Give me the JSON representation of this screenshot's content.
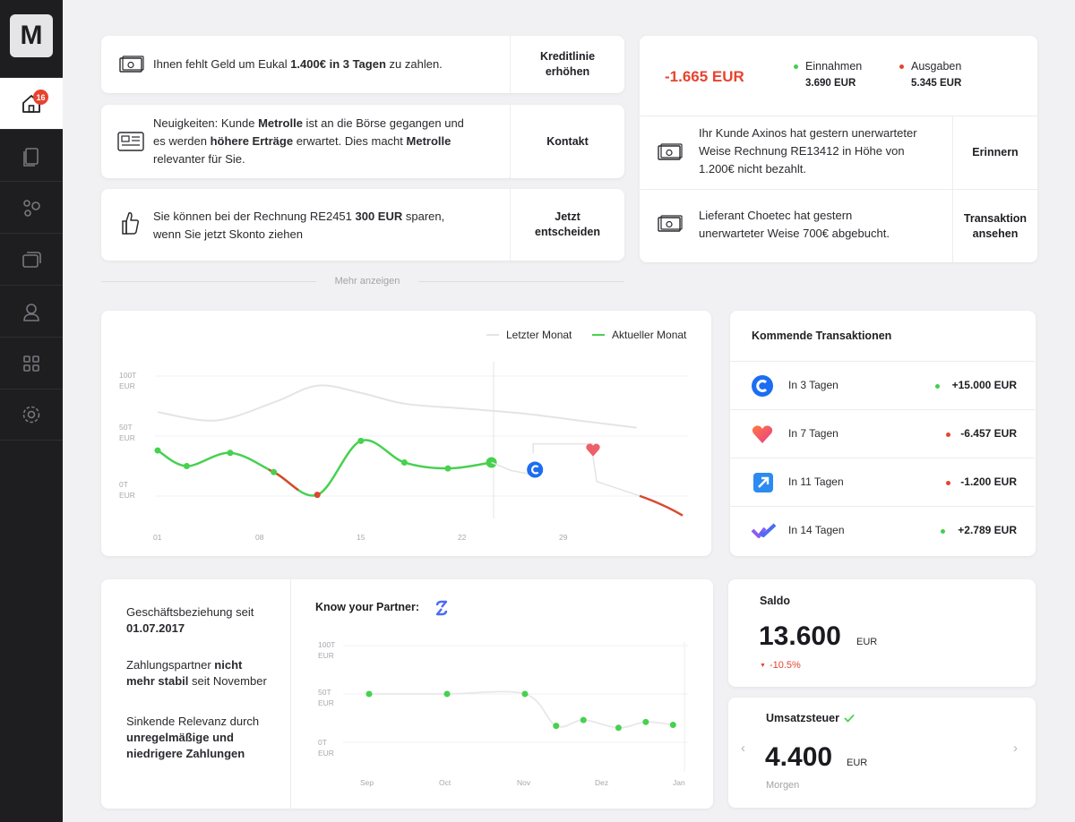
{
  "sidebar": {
    "logo": "M",
    "badge_count": "16",
    "items": [
      {
        "icon": "home-icon"
      },
      {
        "icon": "documents-icon"
      },
      {
        "icon": "network-icon"
      },
      {
        "icon": "cards-icon"
      },
      {
        "icon": "user-icon"
      },
      {
        "icon": "apps-icon"
      },
      {
        "icon": "settings-icon"
      }
    ]
  },
  "notifications": [
    {
      "pre": "Ihnen fehlt Geld um Eukal ",
      "b1": "1.400€ in 3 Tagen",
      "post": " zu zahlen.",
      "action": "Kreditlinie\nerhöhen"
    },
    {
      "l1a": "Neuigkeiten: Kunde ",
      "l1b": "Metrolle",
      "l1c": " ist an die Börse gegangen und",
      "l2a": "es werden ",
      "l2b": "höhere Erträge",
      "l2c": " erwartet. Dies macht ",
      "l2d": "Metrolle",
      "l3": "relevanter für Sie.",
      "action": "Kontakt"
    },
    {
      "l1a": "Sie können bei der Rechnung RE2451 ",
      "l1b": "300 EUR",
      "l1c": " sparen,",
      "l2": "wenn Sie jetzt Skonto ziehen",
      "action": "Jetzt\nentscheiden"
    }
  ],
  "more_link": "Mehr anzeigen",
  "cashflow": {
    "amount": "-1.665 EUR",
    "income_label": "Einnahmen",
    "income_value": "3.690 EUR",
    "expense_label": "Ausgaben",
    "expense_value": "5.345 EUR",
    "income_color": "#3fcf4f",
    "expense_color": "#e8432f",
    "alerts": [
      {
        "l1": "Ihr Kunde Axinos hat gestern unerwarteter",
        "l2": "Weise Rechnung RE13412 in Höhe von",
        "l3": "1.200€ nicht bezahlt.",
        "action": "Erinnern"
      },
      {
        "l1": "Lieferant Choetec hat gestern",
        "l2": "unerwarteter Weise 700€ abgebucht.",
        "action": "Transaktion\nansehen"
      }
    ]
  },
  "chart_data": [
    {
      "type": "line",
      "legend": [
        "Letzter Monat",
        "Aktueller Monat"
      ],
      "legend_placement": "top-right",
      "ylabels": [
        "100T\nEUR",
        "50T\nEUR",
        "0T\nEUR"
      ],
      "xlabels": [
        "01",
        "08",
        "15",
        "22",
        "29"
      ],
      "ylim": [
        0,
        100
      ],
      "series": [
        {
          "name": "Letzter Monat",
          "x": [
            1,
            5,
            9,
            12,
            15,
            18,
            22,
            26,
            30,
            34
          ],
          "values": [
            70,
            63,
            78,
            92,
            86,
            77,
            73,
            69,
            63,
            57
          ],
          "color": "#e4e4e8"
        },
        {
          "name": "Aktueller Monat",
          "x": [
            1,
            3,
            6,
            9,
            12,
            15,
            18,
            21,
            24
          ],
          "values": [
            38,
            25,
            36,
            20,
            1,
            46,
            28,
            23,
            28
          ],
          "color": "#47d14f"
        }
      ],
      "markers": [
        {
          "x": 27,
          "y": 22,
          "icon": "c-logo-icon"
        },
        {
          "x": 31,
          "y": 39,
          "icon": "heart-logo-icon"
        }
      ]
    },
    {
      "type": "line",
      "ylabels": [
        "100T\nEUR",
        "50T\nEUR",
        "0T\nEUR"
      ],
      "xlabels": [
        "Sep",
        "Oct",
        "Nov",
        "Dez",
        "Jan"
      ],
      "ylim": [
        0,
        100
      ],
      "series": [
        {
          "x": [
            0,
            1,
            2,
            2.4,
            2.75,
            3.2,
            3.55,
            3.9
          ],
          "values": [
            50,
            50,
            50,
            17,
            23,
            15,
            21,
            18
          ],
          "color": "#47d14f"
        }
      ]
    }
  ],
  "upcoming": {
    "title": "Kommende Transaktionen",
    "items": [
      {
        "when": "In 3 Tagen",
        "amount": "+15.000 EUR",
        "color": "#3fcf4f",
        "logo": "c-logo-icon"
      },
      {
        "when": "In 7 Tagen",
        "amount": "-6.457 EUR",
        "color": "#e8432f",
        "logo": "heart-logo-icon"
      },
      {
        "when": "In 11 Tagen",
        "amount": "-1.200 EUR",
        "color": "#e8432f",
        "logo": "arrow-logo-icon"
      },
      {
        "when": "In 14 Tagen",
        "amount": "+2.789 EUR",
        "color": "#3fcf4f",
        "logo": "check-logo-icon"
      }
    ]
  },
  "partner": {
    "since_label": "Geschäftsbeziehung seit",
    "since_date": "01.07.2017",
    "p2a": "Zahlungspartner ",
    "p2b": "nicht",
    "p2c": "mehr stabil",
    "p2d": " seit November",
    "p3a": "Sinkende Relevanz durch",
    "p3b": "unregelmäßige und",
    "p3c": "niedrigere Zahlungen",
    "chart_title": "Know your Partner:"
  },
  "saldo": {
    "label": "Saldo",
    "value": "13.600",
    "unit": "EUR",
    "change": "-10.5%"
  },
  "tax": {
    "label": "Umsatzsteuer",
    "value": "4.400",
    "unit": "EUR",
    "when": "Morgen"
  }
}
